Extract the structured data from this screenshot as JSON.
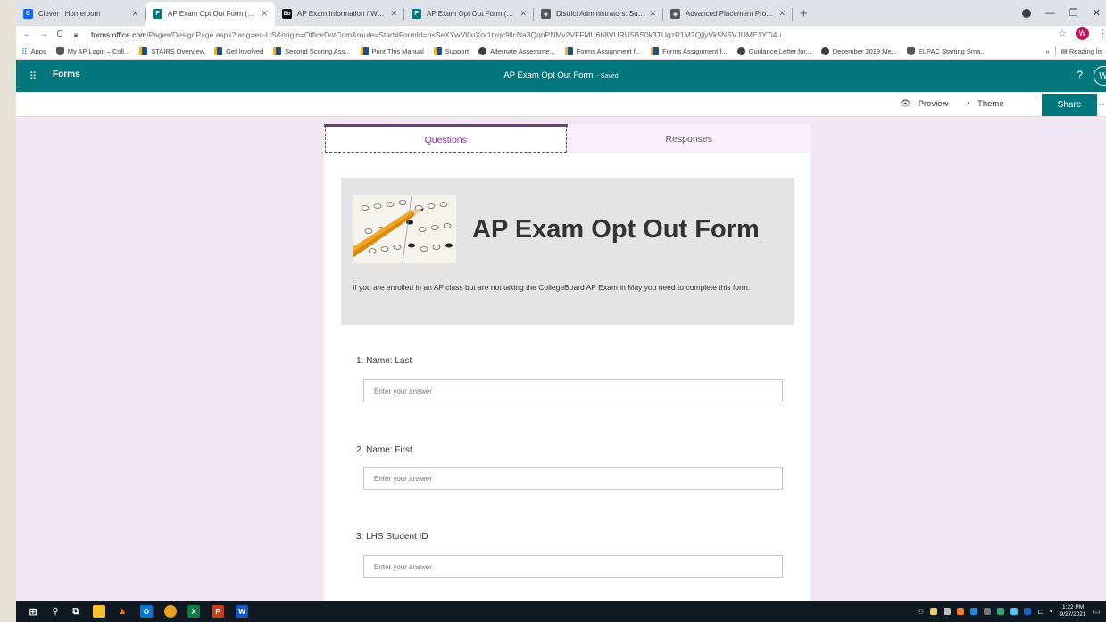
{
  "browser": {
    "tabs": [
      {
        "label": "Clever | Homeroom",
        "color": "#1464ff",
        "glyph": "C",
        "active": false
      },
      {
        "label": "AP Exam Opt Out Form (Edit) M",
        "color": "#03787c",
        "glyph": "F",
        "active": true
      },
      {
        "label": "AP Exam Information / Welcome",
        "color": "#111111",
        "glyph": "Bb",
        "active": false
      },
      {
        "label": "AP Exam Opt Out Form (Previe",
        "color": "#03787c",
        "glyph": "F",
        "active": false
      },
      {
        "label": "District Administrators: Support",
        "color": "#555555",
        "glyph": "◈",
        "active": false
      },
      {
        "label": "Advanced Placement Program -",
        "color": "#555555",
        "glyph": "◈",
        "active": false
      }
    ],
    "new_tab": "+",
    "url_host": "forms.office.com",
    "url_rest": "/Pages/DesignPage.aspx?lang=en-US&origin=OfficeDotCom&route=Start#FormId=bsSeXYwVl0uXor1txqc9llcNa3QqnPNMv2VFFMU6h8VURU5BS0k3TUgzR1M2QjlyVk5NSVJUME1YTi4u",
    "profile_initial": "W",
    "bookmarks": [
      {
        "label": "Apps",
        "icon": "apps"
      },
      {
        "label": "My AP Login – Coll...",
        "icon": "shield"
      },
      {
        "label": "STAIRS Overview",
        "icon": "flag"
      },
      {
        "label": "Get Involved",
        "icon": "flag"
      },
      {
        "label": "Second Scoring Ass...",
        "icon": "flag"
      },
      {
        "label": "Print This Manual",
        "icon": "flag"
      },
      {
        "label": "Support",
        "icon": "flag"
      },
      {
        "label": "Alternate Assessme...",
        "icon": "cap"
      },
      {
        "label": "Forms Assignment f...",
        "icon": "flag"
      },
      {
        "label": "Forms Assignment f...",
        "icon": "flag"
      },
      {
        "label": "Guidance Letter for...",
        "icon": "cap"
      },
      {
        "label": "December 2019 Me...",
        "icon": "cap"
      },
      {
        "label": "ELPAC Starting Sma...",
        "icon": "shield"
      }
    ],
    "bookmarks_overflow": "»",
    "reading_list": "Reading lis"
  },
  "forms_header": {
    "brand": "Forms",
    "title": "AP Exam Opt Out Form",
    "status": "- Saved",
    "help": "?",
    "user_initial": "W"
  },
  "command_bar": {
    "preview": "Preview",
    "theme": "Theme",
    "share": "Share",
    "more": "···"
  },
  "form_tabs": {
    "questions": "Questions",
    "responses": "Responses"
  },
  "form": {
    "title": "AP Exam Opt Out Form",
    "description": "If you are enrolled in an AP class but are not taking the CollegeBoard AP Exam in May you need to complete this form.",
    "questions": [
      {
        "label": "1. Name: Last",
        "placeholder": "Enter your answer"
      },
      {
        "label": "2. Name: First",
        "placeholder": "Enter your answer"
      },
      {
        "label": "3. LHS Student ID",
        "placeholder": "Enter your answer"
      }
    ]
  },
  "taskbar": {
    "time": "1:22 PM",
    "date": "9/27/2021"
  }
}
